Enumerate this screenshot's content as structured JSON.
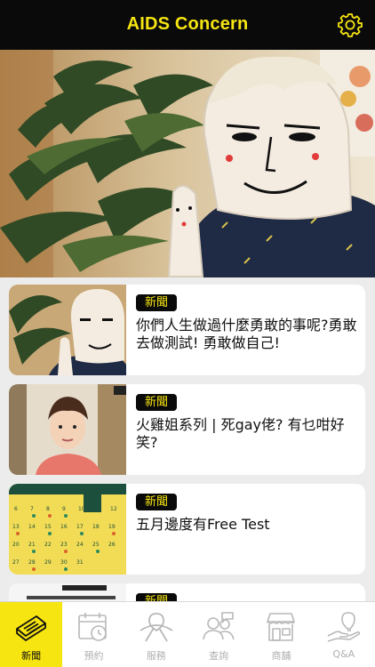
{
  "header": {
    "title": "AIDS Concern",
    "settings_icon": "gear-icon"
  },
  "hero": {
    "image": "mascot-video-still"
  },
  "news": [
    {
      "tag": "新聞",
      "title": "你們人生做過什麼勇敢的事呢?勇敢去做測試! 勇敢做自己!"
    },
    {
      "tag": "新聞",
      "title": "火雞姐系列 | 死gay佬? 有乜咁好笑?"
    },
    {
      "tag": "新聞",
      "title": "五月邊度有Free Test"
    },
    {
      "tag": "新聞",
      "title": ""
    }
  ],
  "tabs": [
    {
      "label": "新聞",
      "icon": "newspaper-icon",
      "active": true
    },
    {
      "label": "預約",
      "icon": "calendar-clock-icon",
      "active": false
    },
    {
      "label": "服務",
      "icon": "ribbon-icon",
      "active": false
    },
    {
      "label": "查詢",
      "icon": "people-chat-icon",
      "active": false
    },
    {
      "label": "商舖",
      "icon": "shop-icon",
      "active": false
    },
    {
      "label": "Q&A",
      "icon": "lightbulb-icon",
      "active": false
    }
  ],
  "colors": {
    "brand_yellow": "#f6e511",
    "header_black": "#0a0a0a",
    "background": "#ececec"
  }
}
